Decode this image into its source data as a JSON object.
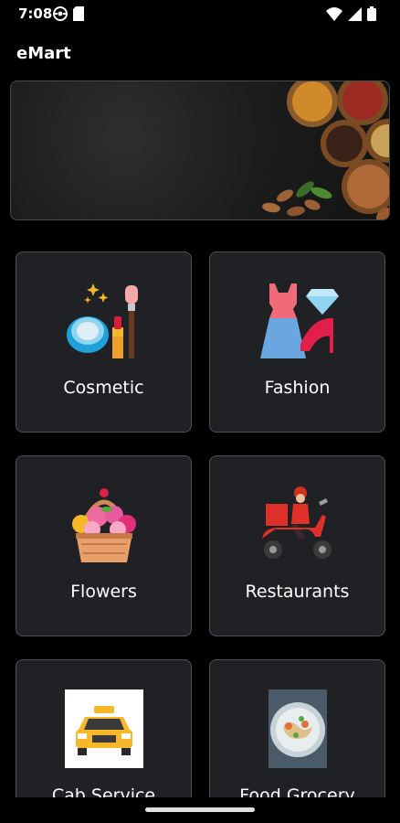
{
  "status_bar": {
    "time": "7:08",
    "left_icons": [
      "android-system-icon",
      "sim-card-icon"
    ],
    "right_icons": [
      "wifi-icon",
      "signal-icon",
      "battery-icon"
    ]
  },
  "app_bar": {
    "title": "eMart"
  },
  "banner": {
    "image": "dried-fruits-nuts-banner"
  },
  "categories": [
    {
      "label": "Cosmetic",
      "icon": "cosmetic-icon"
    },
    {
      "label": "Fashion",
      "icon": "fashion-icon"
    },
    {
      "label": "Flowers",
      "icon": "flowers-icon"
    },
    {
      "label": "Restaurants",
      "icon": "restaurant-delivery-icon"
    },
    {
      "label": "Cab Service",
      "icon": "taxi-icon"
    },
    {
      "label": "Food Grocery",
      "icon": "food-plate-icon"
    }
  ],
  "colors": {
    "background": "#000000",
    "card": "#202124",
    "card_border": "#4f5052",
    "text": "#ffffff"
  }
}
